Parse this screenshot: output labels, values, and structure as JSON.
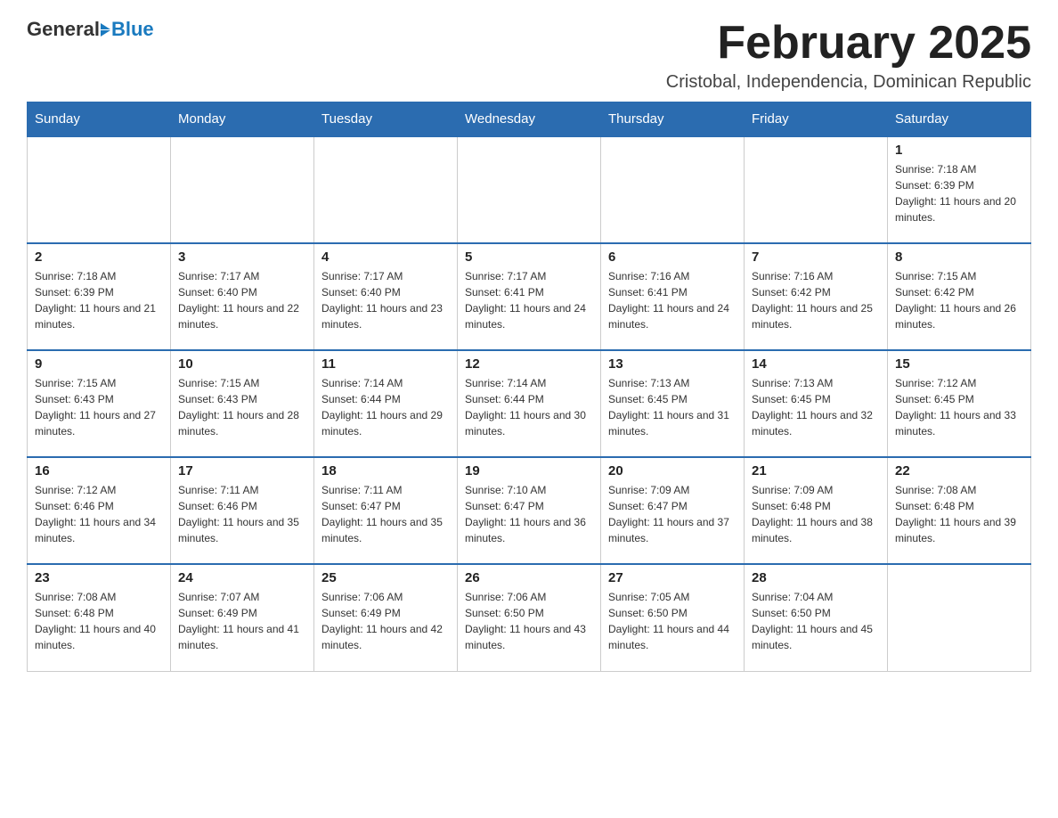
{
  "header": {
    "logo_general": "General",
    "logo_blue": "Blue",
    "month_title": "February 2025",
    "location": "Cristobal, Independencia, Dominican Republic"
  },
  "days_of_week": [
    "Sunday",
    "Monday",
    "Tuesday",
    "Wednesday",
    "Thursday",
    "Friday",
    "Saturday"
  ],
  "weeks": [
    [
      {
        "day": "",
        "info": ""
      },
      {
        "day": "",
        "info": ""
      },
      {
        "day": "",
        "info": ""
      },
      {
        "day": "",
        "info": ""
      },
      {
        "day": "",
        "info": ""
      },
      {
        "day": "",
        "info": ""
      },
      {
        "day": "1",
        "info": "Sunrise: 7:18 AM\nSunset: 6:39 PM\nDaylight: 11 hours and 20 minutes."
      }
    ],
    [
      {
        "day": "2",
        "info": "Sunrise: 7:18 AM\nSunset: 6:39 PM\nDaylight: 11 hours and 21 minutes."
      },
      {
        "day": "3",
        "info": "Sunrise: 7:17 AM\nSunset: 6:40 PM\nDaylight: 11 hours and 22 minutes."
      },
      {
        "day": "4",
        "info": "Sunrise: 7:17 AM\nSunset: 6:40 PM\nDaylight: 11 hours and 23 minutes."
      },
      {
        "day": "5",
        "info": "Sunrise: 7:17 AM\nSunset: 6:41 PM\nDaylight: 11 hours and 24 minutes."
      },
      {
        "day": "6",
        "info": "Sunrise: 7:16 AM\nSunset: 6:41 PM\nDaylight: 11 hours and 24 minutes."
      },
      {
        "day": "7",
        "info": "Sunrise: 7:16 AM\nSunset: 6:42 PM\nDaylight: 11 hours and 25 minutes."
      },
      {
        "day": "8",
        "info": "Sunrise: 7:15 AM\nSunset: 6:42 PM\nDaylight: 11 hours and 26 minutes."
      }
    ],
    [
      {
        "day": "9",
        "info": "Sunrise: 7:15 AM\nSunset: 6:43 PM\nDaylight: 11 hours and 27 minutes."
      },
      {
        "day": "10",
        "info": "Sunrise: 7:15 AM\nSunset: 6:43 PM\nDaylight: 11 hours and 28 minutes."
      },
      {
        "day": "11",
        "info": "Sunrise: 7:14 AM\nSunset: 6:44 PM\nDaylight: 11 hours and 29 minutes."
      },
      {
        "day": "12",
        "info": "Sunrise: 7:14 AM\nSunset: 6:44 PM\nDaylight: 11 hours and 30 minutes."
      },
      {
        "day": "13",
        "info": "Sunrise: 7:13 AM\nSunset: 6:45 PM\nDaylight: 11 hours and 31 minutes."
      },
      {
        "day": "14",
        "info": "Sunrise: 7:13 AM\nSunset: 6:45 PM\nDaylight: 11 hours and 32 minutes."
      },
      {
        "day": "15",
        "info": "Sunrise: 7:12 AM\nSunset: 6:45 PM\nDaylight: 11 hours and 33 minutes."
      }
    ],
    [
      {
        "day": "16",
        "info": "Sunrise: 7:12 AM\nSunset: 6:46 PM\nDaylight: 11 hours and 34 minutes."
      },
      {
        "day": "17",
        "info": "Sunrise: 7:11 AM\nSunset: 6:46 PM\nDaylight: 11 hours and 35 minutes."
      },
      {
        "day": "18",
        "info": "Sunrise: 7:11 AM\nSunset: 6:47 PM\nDaylight: 11 hours and 35 minutes."
      },
      {
        "day": "19",
        "info": "Sunrise: 7:10 AM\nSunset: 6:47 PM\nDaylight: 11 hours and 36 minutes."
      },
      {
        "day": "20",
        "info": "Sunrise: 7:09 AM\nSunset: 6:47 PM\nDaylight: 11 hours and 37 minutes."
      },
      {
        "day": "21",
        "info": "Sunrise: 7:09 AM\nSunset: 6:48 PM\nDaylight: 11 hours and 38 minutes."
      },
      {
        "day": "22",
        "info": "Sunrise: 7:08 AM\nSunset: 6:48 PM\nDaylight: 11 hours and 39 minutes."
      }
    ],
    [
      {
        "day": "23",
        "info": "Sunrise: 7:08 AM\nSunset: 6:48 PM\nDaylight: 11 hours and 40 minutes."
      },
      {
        "day": "24",
        "info": "Sunrise: 7:07 AM\nSunset: 6:49 PM\nDaylight: 11 hours and 41 minutes."
      },
      {
        "day": "25",
        "info": "Sunrise: 7:06 AM\nSunset: 6:49 PM\nDaylight: 11 hours and 42 minutes."
      },
      {
        "day": "26",
        "info": "Sunrise: 7:06 AM\nSunset: 6:50 PM\nDaylight: 11 hours and 43 minutes."
      },
      {
        "day": "27",
        "info": "Sunrise: 7:05 AM\nSunset: 6:50 PM\nDaylight: 11 hours and 44 minutes."
      },
      {
        "day": "28",
        "info": "Sunrise: 7:04 AM\nSunset: 6:50 PM\nDaylight: 11 hours and 45 minutes."
      },
      {
        "day": "",
        "info": ""
      }
    ]
  ]
}
